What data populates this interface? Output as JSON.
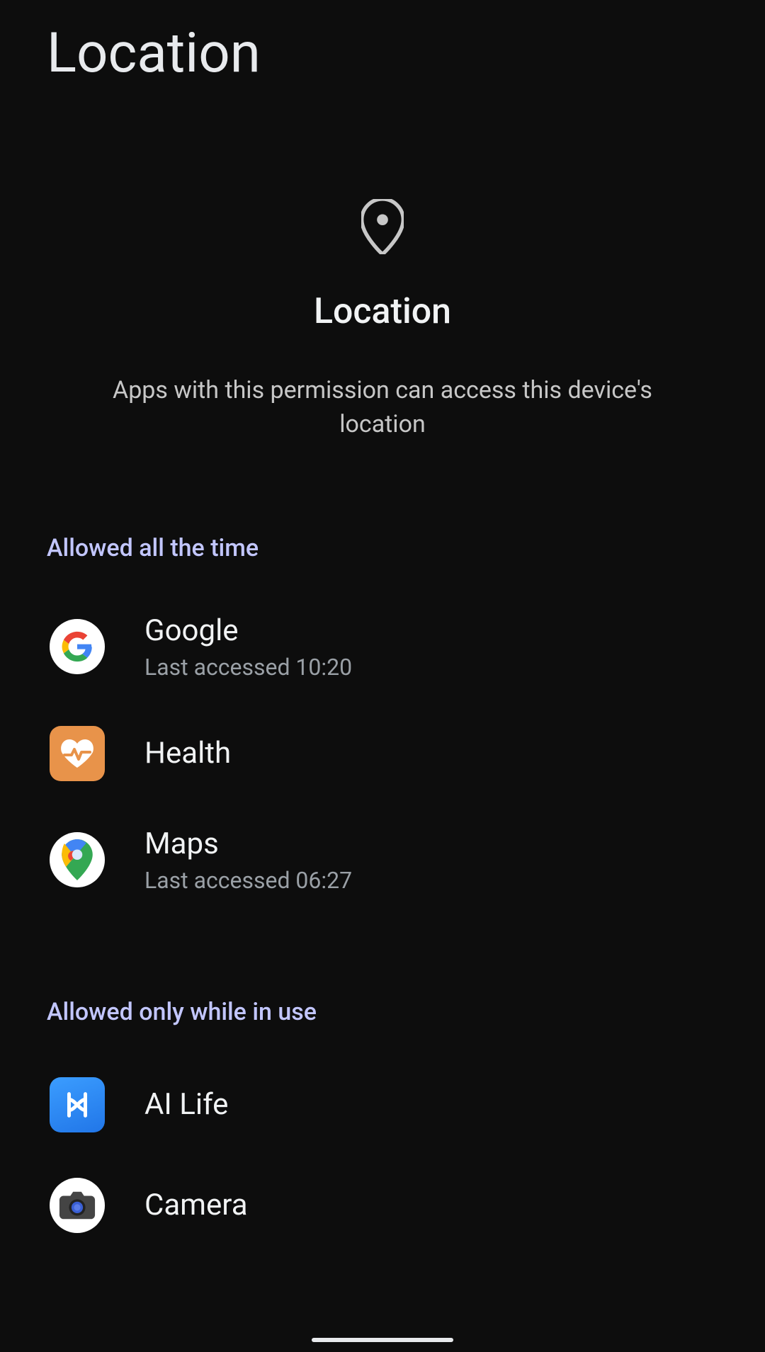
{
  "page_title": "Location",
  "hero": {
    "title": "Location",
    "description": "Apps with this permission can access this device's location"
  },
  "sections": [
    {
      "header": "Allowed all the time",
      "items": [
        {
          "name": "Google",
          "sub": "Last accessed 10:20",
          "icon": "google"
        },
        {
          "name": "Health",
          "sub": "",
          "icon": "health"
        },
        {
          "name": "Maps",
          "sub": "Last accessed 06:27",
          "icon": "maps"
        }
      ]
    },
    {
      "header": "Allowed only while in use",
      "items": [
        {
          "name": "AI Life",
          "sub": "",
          "icon": "ailife"
        },
        {
          "name": "Camera",
          "sub": "",
          "icon": "camera"
        }
      ]
    }
  ]
}
